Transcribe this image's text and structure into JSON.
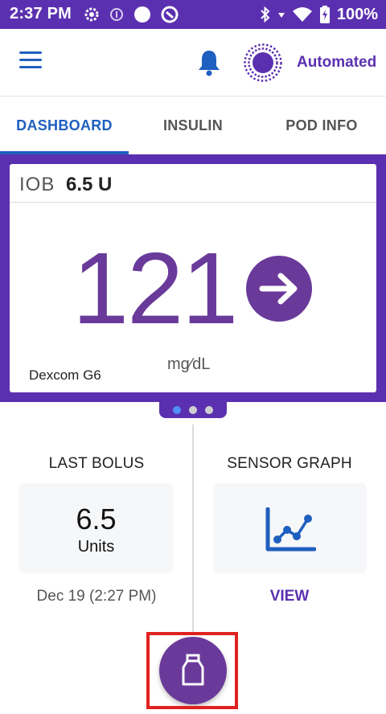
{
  "status_bar": {
    "time": "2:37 PM",
    "battery": "100%",
    "icons": [
      "sync-icon",
      "pod-status-icon",
      "circle-icon",
      "app-notification-icon",
      "bluetooth-icon",
      "wifi-icon",
      "battery-icon"
    ]
  },
  "app_bar": {
    "menu_icon": "hamburger-menu-icon",
    "bell_icon": "bell-icon",
    "mode_icon": "automated-mode-icon",
    "mode_label": "Automated"
  },
  "tabs": [
    {
      "label": "DASHBOARD",
      "active": true
    },
    {
      "label": "INSULIN",
      "active": false
    },
    {
      "label": "POD INFO",
      "active": false
    }
  ],
  "dashboard": {
    "iob_label": "IOB",
    "iob_value": "6.5 U",
    "glucose_value": "121",
    "glucose_unit": "mg∕dL",
    "trend": "steady-arrow-right",
    "sensor": "Dexcom G6",
    "pager": {
      "count": 3,
      "active_index": 0
    }
  },
  "last_bolus": {
    "title": "LAST BOLUS",
    "value": "6.5",
    "unit": "Units",
    "date": "Dec 19 (2:27 PM)"
  },
  "sensor_graph": {
    "title": "SENSOR GRAPH",
    "icon": "line-chart-icon",
    "link": "VIEW"
  },
  "fab": {
    "icon": "insulin-vial-icon"
  },
  "colors": {
    "primary": "#5b30b0",
    "glucose": "#6a3a9a",
    "accent_blue": "#1f5fbf",
    "highlight": "#e0221f"
  }
}
